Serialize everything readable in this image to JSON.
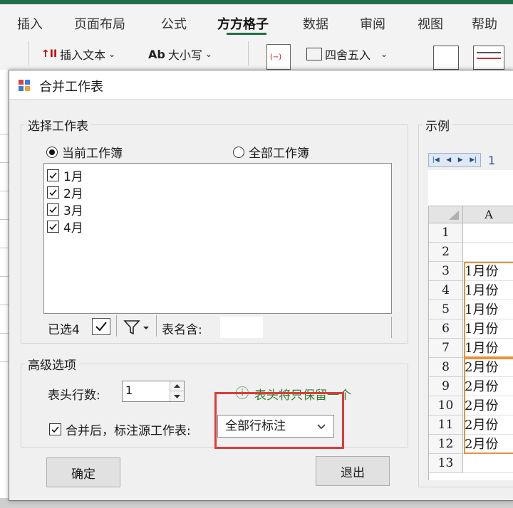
{
  "ribbon": {
    "tabs": [
      "插入",
      "页面布局",
      "公式",
      "方方格子",
      "数据",
      "审阅",
      "视图",
      "帮助"
    ],
    "active_tab": "方方格子",
    "tools": {
      "insert_text": "插入文本",
      "case": "大小写",
      "round": "四舍五入"
    }
  },
  "dialog": {
    "title": "合并工作表",
    "select_group": {
      "label": "选择工作表",
      "radio_current": "当前工作簿",
      "radio_all": "全部工作簿",
      "selected_radio": "current",
      "sheets": [
        {
          "name": "1月",
          "checked": true
        },
        {
          "name": "2月",
          "checked": true
        },
        {
          "name": "3月",
          "checked": true
        },
        {
          "name": "4月",
          "checked": true
        }
      ],
      "selected_count": "已选4",
      "name_contains_label": "表名含:",
      "name_contains_value": ""
    },
    "advanced_group": {
      "label": "高级选项",
      "header_rows_label": "表头行数:",
      "header_rows_value": "1",
      "hint_text": "表头将只保留一个",
      "annotate_label": "合并后，标注源工作表:",
      "annotate_checked": true,
      "annotate_option": "全部行标注"
    },
    "ok_button": "确定",
    "exit_button": "退出",
    "example": {
      "label": "示例",
      "sheet_tab_partial": "1",
      "column_header": "A",
      "rows": [
        {
          "num": "1",
          "value": ""
        },
        {
          "num": "2",
          "value": ""
        },
        {
          "num": "3",
          "value": "1月份"
        },
        {
          "num": "4",
          "value": "1月份"
        },
        {
          "num": "5",
          "value": "1月份"
        },
        {
          "num": "6",
          "value": "1月份"
        },
        {
          "num": "7",
          "value": "1月份"
        },
        {
          "num": "8",
          "value": "2月份"
        },
        {
          "num": "9",
          "value": "2月份"
        },
        {
          "num": "10",
          "value": "2月份"
        },
        {
          "num": "11",
          "value": "2月份"
        },
        {
          "num": "12",
          "value": "2月份"
        },
        {
          "num": "13",
          "value": ""
        }
      ],
      "highlight_color": "#e8913a"
    }
  },
  "colors": {
    "excel_green": "#1e7145",
    "highlight_red": "#e03a3a"
  }
}
